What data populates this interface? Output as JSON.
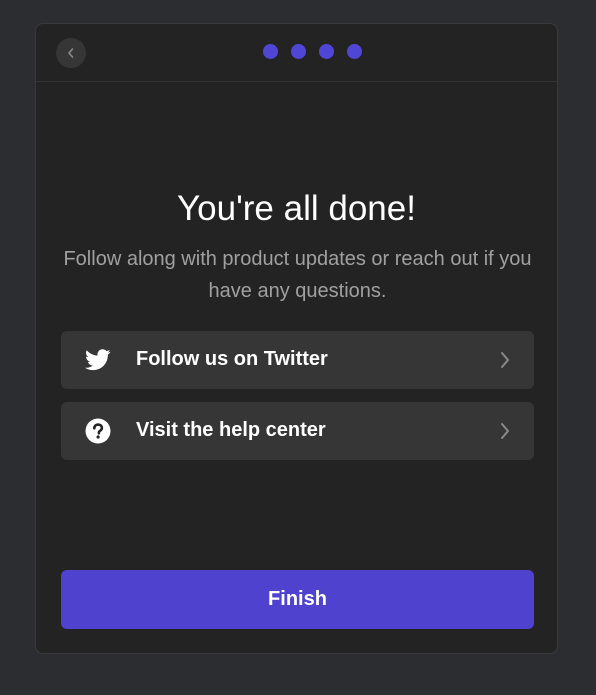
{
  "header": {
    "back_icon": "chevron-left-icon",
    "steps_total": 4,
    "active_color": "#5046d6"
  },
  "content": {
    "title": "You're all done!",
    "subtitle": "Follow along with product updates or reach out if you have any questions."
  },
  "links": [
    {
      "label": "Follow us on Twitter",
      "icon": "twitter-icon"
    },
    {
      "label": "Visit the help center",
      "icon": "question-circle-icon"
    }
  ],
  "footer": {
    "finish_label": "Finish",
    "button_color": "#4f42cf"
  },
  "colors": {
    "background": "#2c2d31",
    "modal": "#232323",
    "row": "#363636",
    "muted_text": "#a0a0a0"
  }
}
